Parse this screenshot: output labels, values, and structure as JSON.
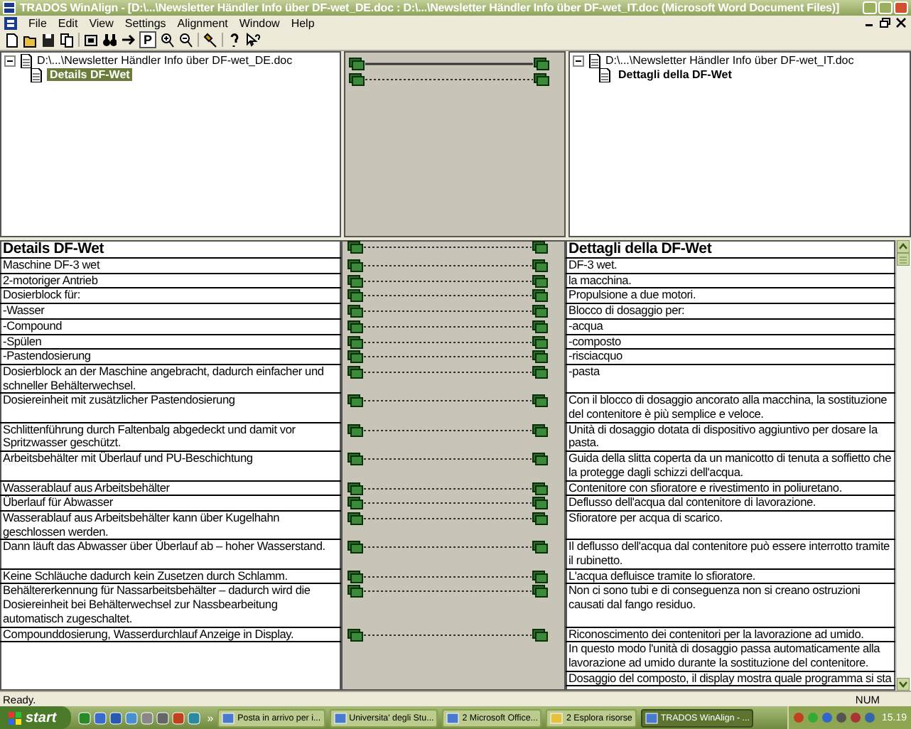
{
  "window": {
    "title": "TRADOS WinAlign - [D:\\...\\Newsletter Händler Info über DF-wet_DE.doc : D:\\...\\Newsletter Händler Info über DF-wet_IT.doc (Microsoft Word Document Files)]"
  },
  "menu": [
    "File",
    "Edit",
    "View",
    "Settings",
    "Alignment",
    "Window",
    "Help"
  ],
  "toolbar": {
    "p_button": {
      "label": "P",
      "pressed": true
    }
  },
  "structure": {
    "source": {
      "file": "D:\\...\\Newsletter Händler Info über DF-wet_DE.doc",
      "expanded": true,
      "children": [
        {
          "label": "Details DF-Wet",
          "selected": true
        }
      ]
    },
    "target": {
      "file": "D:\\...\\Newsletter Händler Info über DF-wet_IT.doc",
      "expanded": true,
      "children": [
        {
          "label": "Dettagli della DF-Wet",
          "selected": false
        }
      ]
    },
    "links": [
      {
        "selected": true
      },
      {
        "selected": false
      }
    ]
  },
  "segments": [
    {
      "kind": "heading",
      "source": "Details DF-Wet",
      "target": "Dettagli della DF-Wet",
      "linked": true
    },
    {
      "kind": "text",
      "source": "Maschine DF-3 wet",
      "target": "DF-3 wet.",
      "linked": true
    },
    {
      "kind": "text",
      "source": "2-motoriger Antrieb",
      "target": "la macchina.",
      "linked": true
    },
    {
      "kind": "text",
      "source": "Dosierblock für:",
      "target": "Propulsione a due motori.",
      "linked": true
    },
    {
      "kind": "text",
      "source": "-Wasser",
      "target": "Blocco di dosaggio per:",
      "linked": true
    },
    {
      "kind": "text",
      "source": "-Compound",
      "target": "-acqua",
      "linked": true
    },
    {
      "kind": "text",
      "source": "-Spülen",
      "target": "-composto",
      "linked": true
    },
    {
      "kind": "text",
      "source": "-Pastendosierung",
      "target": "-risciacquo",
      "linked": true
    },
    {
      "kind": "text",
      "source": "Dosierblock an der Maschine angebracht, dadurch einfacher und schneller Behälterwechsel.",
      "target": "-pasta",
      "linked": true
    },
    {
      "kind": "text",
      "source": "Dosiereinheit mit zusätzlicher Pastendosierung",
      "target": "Con il blocco di dosaggio ancorato alla macchina, la sostituzione del contenitore è più semplice e veloce.",
      "linked": true
    },
    {
      "kind": "text",
      "source": "Schlittenführung durch Faltenbalg abgedeckt und damit vor Spritzwasser geschützt.",
      "target": "Unità di dosaggio dotata di dispositivo aggiuntivo per dosare la pasta.",
      "linked": true
    },
    {
      "kind": "text",
      "source": "Arbeitsbehälter mit Überlauf und PU-Beschichtung",
      "target": "Guida della slitta coperta da un manicotto di tenuta a soffietto che la protegge dagli schizzi dell'acqua.",
      "linked": true
    },
    {
      "kind": "text",
      "source": "Wasserablauf aus Arbeitsbehälter",
      "target": "Contenitore con sfioratore e rivestimento in poliuretano.",
      "linked": true
    },
    {
      "kind": "text",
      "source": "Überlauf für Abwasser",
      "target": "Deflusso dell'acqua dal contenitore di lavorazione.",
      "linked": true
    },
    {
      "kind": "text",
      "source": "Wasserablauf aus Arbeitsbehälter kann über Kugelhahn geschlossen werden.",
      "target": "Sfioratore per acqua di scarico.",
      "linked": true
    },
    {
      "kind": "text",
      "source": "Dann läuft das Abwasser über Überlauf ab – hoher Wasserstand.",
      "target": "Il deflusso dell'acqua dal contenitore può essere interrotto tramite il rubinetto.",
      "linked": true
    },
    {
      "kind": "text",
      "source": "Keine Schläuche dadurch kein Zusetzen durch Schlamm.",
      "target": "L'acqua defluisce tramite lo sfioratore.",
      "linked": true
    },
    {
      "kind": "text",
      "source": "Behältererkennung für Nassarbeitsbehälter – dadurch wird die Dosiereinheit bei Behälterwechsel zur Nassbearbeitung automatisch zugeschaltet.",
      "target": "Non ci sono tubi e di conseguenza non si creano ostruzioni causati dal fango residuo.",
      "linked": true
    },
    {
      "kind": "text",
      "source": "Compounddosierung, Wasserdurchlauf Anzeige in Display.",
      "target": "Riconoscimento dei contenitori per la lavorazione ad umido.",
      "linked": true
    },
    {
      "kind": "text",
      "target": "In questo modo l'unità di dosaggio passa automaticamente alla lavorazione ad umido durante la sostituzione del contenitore.",
      "linked": false
    },
    {
      "kind": "text",
      "target": "Dosaggio del composto, il display mostra quale programma si sta",
      "linked": false
    }
  ],
  "status_bar": {
    "message": "Ready.",
    "indicator": "NUM"
  },
  "taskbar": {
    "start": "start",
    "more": "»",
    "tasks": [
      {
        "label": "Posta in arrivo per i...",
        "selected": false
      },
      {
        "label": "Universita' degli Stu...",
        "selected": false
      },
      {
        "label": "2 Microsoft Office...",
        "selected": false
      },
      {
        "label": "2 Esplora risorse",
        "selected": false
      },
      {
        "label": "TRADOS WinAlign - ...",
        "selected": true
      }
    ],
    "clock": "15.19"
  }
}
